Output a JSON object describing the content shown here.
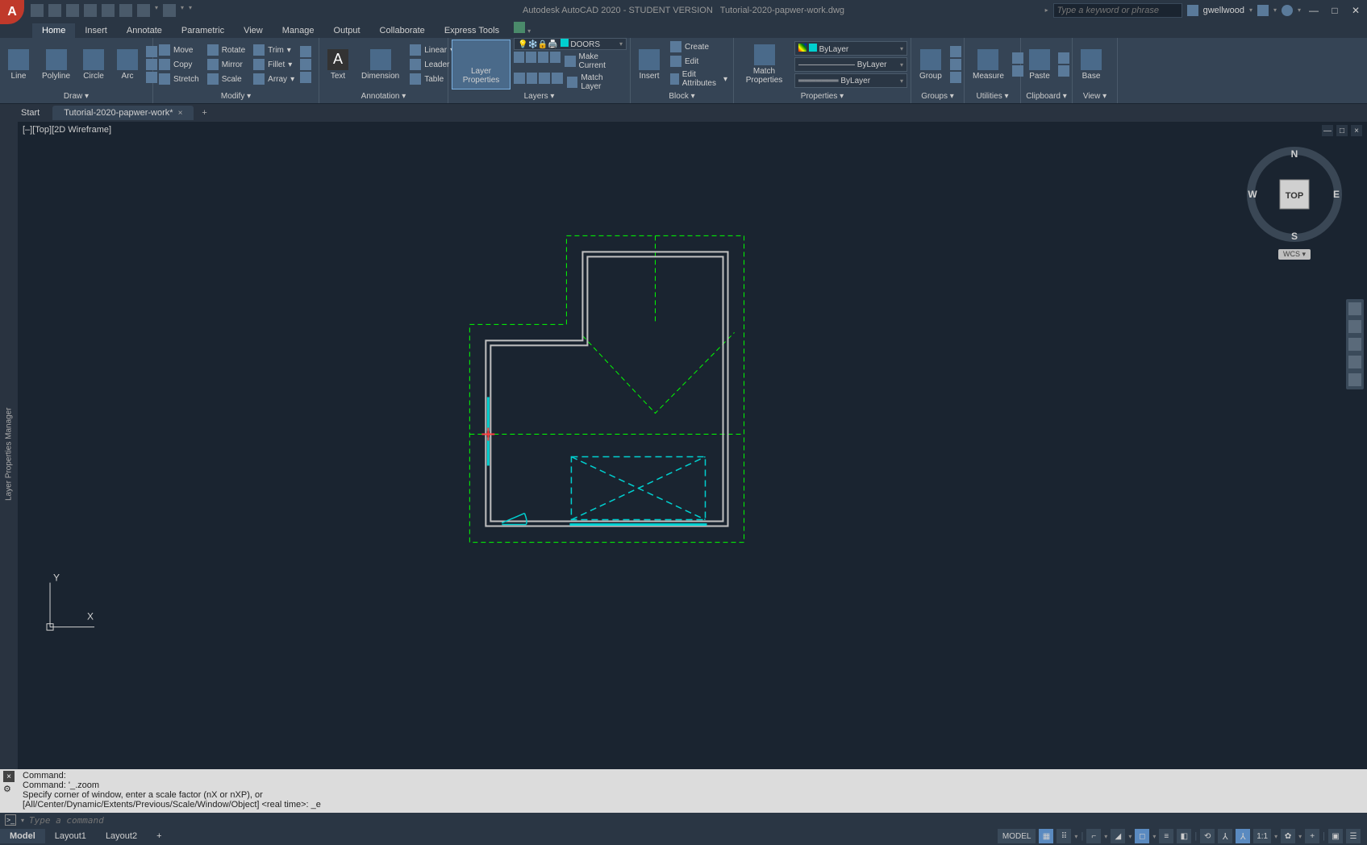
{
  "title": {
    "app": "Autodesk AutoCAD 2020 - STUDENT VERSION",
    "file": "Tutorial-2020-papwer-work.dwg"
  },
  "search": {
    "ph": "Type a keyword or phrase"
  },
  "user": "gwellwood",
  "qat_icons": [
    "new",
    "open",
    "save",
    "saveas",
    "plot-web",
    "plot",
    "undo",
    "redo"
  ],
  "menu_tabs": [
    "Home",
    "Insert",
    "Annotate",
    "Parametric",
    "View",
    "Manage",
    "Output",
    "Collaborate",
    "Express Tools"
  ],
  "menu_active": 0,
  "ribbon": {
    "draw": {
      "title": "Draw",
      "big": [
        "Line",
        "Polyline",
        "Circle",
        "Arc"
      ]
    },
    "modify": {
      "title": "Modify",
      "rows": [
        [
          "Move",
          "Rotate",
          "Trim"
        ],
        [
          "Copy",
          "Mirror",
          "Fillet"
        ],
        [
          "Stretch",
          "Scale",
          "Array"
        ]
      ]
    },
    "annotation": {
      "title": "Annotation",
      "big": [
        "Text",
        "Dimension"
      ],
      "rows": [
        "Linear",
        "Leader",
        "Table"
      ]
    },
    "layers": {
      "title": "Layers",
      "big": "Layer Properties",
      "dd": "DOORS",
      "rows": [
        "Make Current",
        "Match Layer"
      ]
    },
    "block": {
      "title": "Block",
      "big": "Insert",
      "rows": [
        "Create",
        "Edit",
        "Edit Attributes"
      ]
    },
    "properties": {
      "title": "Properties",
      "big": "Match Properties",
      "dd1": "ByLayer",
      "dd2": "ByLayer",
      "dd3": "ByLayer"
    },
    "groups": {
      "title": "Groups",
      "big": "Group"
    },
    "utilities": {
      "title": "Utilities",
      "big": "Measure"
    },
    "clipboard": {
      "title": "Clipboard",
      "big": "Paste"
    },
    "view": {
      "title": "View",
      "big": "Base"
    }
  },
  "file_tabs": {
    "start": "Start",
    "file": "Tutorial-2020-papwer-work*"
  },
  "side_palette": "Layer Properties Manager",
  "viewport_label": "[–][Top][2D Wireframe]",
  "viewcube": {
    "top": "TOP",
    "n": "N",
    "s": "S",
    "e": "E",
    "w": "W",
    "wcs": "WCS"
  },
  "ucs": {
    "x": "X",
    "y": "Y"
  },
  "cmd_history": [
    "Command:",
    "Command: '_.zoom",
    "Specify corner of window, enter a scale factor (nX or nXP), or",
    "[All/Center/Dynamic/Extents/Previous/Scale/Window/Object] <real time>: _e"
  ],
  "cmd_ph": "Type a command",
  "layouts": [
    "Model",
    "Layout1",
    "Layout2"
  ],
  "status_right": {
    "model": "MODEL",
    "scale": "1:1"
  }
}
